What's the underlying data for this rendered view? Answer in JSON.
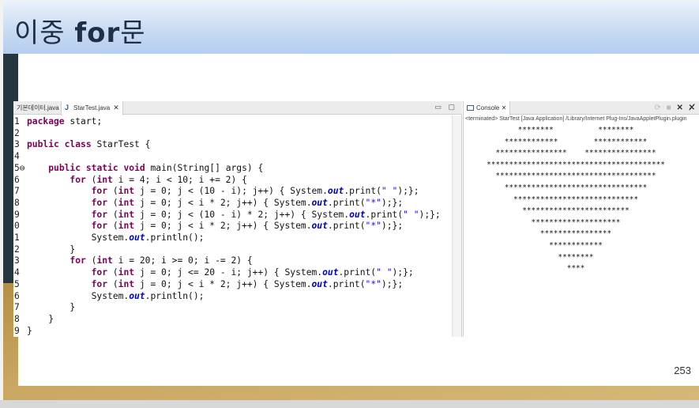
{
  "slide": {
    "title_korean_1": "이중 ",
    "title_bold": "for",
    "title_korean_2": "문",
    "page_number": "253"
  },
  "editor": {
    "tabs": [
      {
        "label": "기본데이터.java",
        "active": false
      },
      {
        "label": "StarTest.java",
        "active": true,
        "close": "✕",
        "icon": "J"
      }
    ],
    "controls": "▭ ▢",
    "lines": [
      {
        "num": "1",
        "segs": [
          [
            "kw",
            "package"
          ],
          [
            "plain",
            " start;"
          ]
        ]
      },
      {
        "num": "2",
        "segs": []
      },
      {
        "num": "3",
        "segs": [
          [
            "kw",
            "public"
          ],
          [
            "plain",
            " "
          ],
          [
            "kw",
            "class"
          ],
          [
            "plain",
            " StarTest {"
          ]
        ]
      },
      {
        "num": "4",
        "segs": []
      },
      {
        "num": "5⊖",
        "segs": [
          [
            "plain",
            "    "
          ],
          [
            "kw",
            "public"
          ],
          [
            "plain",
            " "
          ],
          [
            "kw",
            "static"
          ],
          [
            "plain",
            " "
          ],
          [
            "kw",
            "void"
          ],
          [
            "plain",
            " main(String[] args) {"
          ]
        ]
      },
      {
        "num": "6",
        "segs": [
          [
            "plain",
            "        "
          ],
          [
            "kw",
            "for"
          ],
          [
            "plain",
            " ("
          ],
          [
            "kw",
            "int"
          ],
          [
            "plain",
            " i = 4; i < 10; i += 2) {"
          ]
        ]
      },
      {
        "num": "7",
        "segs": [
          [
            "plain",
            "            "
          ],
          [
            "kw",
            "for"
          ],
          [
            "plain",
            " ("
          ],
          [
            "kw",
            "int"
          ],
          [
            "plain",
            " j = 0; j < (10 - i); j++) { System."
          ],
          [
            "fld",
            "out"
          ],
          [
            "plain",
            ".print("
          ],
          [
            "str",
            "\" \""
          ],
          [
            "plain",
            ");};"
          ]
        ]
      },
      {
        "num": "8",
        "segs": [
          [
            "plain",
            "            "
          ],
          [
            "kw",
            "for"
          ],
          [
            "plain",
            " ("
          ],
          [
            "kw",
            "int"
          ],
          [
            "plain",
            " j = 0; j < i * 2; j++) { System."
          ],
          [
            "fld",
            "out"
          ],
          [
            "plain",
            ".print("
          ],
          [
            "str",
            "\"*\""
          ],
          [
            "plain",
            ");};"
          ]
        ]
      },
      {
        "num": "9",
        "segs": [
          [
            "plain",
            "            "
          ],
          [
            "kw",
            "for"
          ],
          [
            "plain",
            " ("
          ],
          [
            "kw",
            "int"
          ],
          [
            "plain",
            " j = 0; j < (10 - i) * 2; j++) { System."
          ],
          [
            "fld",
            "out"
          ],
          [
            "plain",
            ".print("
          ],
          [
            "str",
            "\" \""
          ],
          [
            "plain",
            ");};"
          ]
        ]
      },
      {
        "num": "0",
        "segs": [
          [
            "plain",
            "            "
          ],
          [
            "kw",
            "for"
          ],
          [
            "plain",
            " ("
          ],
          [
            "kw",
            "int"
          ],
          [
            "plain",
            " j = 0; j < i * 2; j++) { System."
          ],
          [
            "fld",
            "out"
          ],
          [
            "plain",
            ".print("
          ],
          [
            "str",
            "\"*\""
          ],
          [
            "plain",
            ");};"
          ]
        ]
      },
      {
        "num": "1",
        "segs": [
          [
            "plain",
            "            System."
          ],
          [
            "fld",
            "out"
          ],
          [
            "plain",
            ".println();"
          ]
        ]
      },
      {
        "num": "2",
        "segs": [
          [
            "plain",
            "        }"
          ]
        ]
      },
      {
        "num": "3",
        "segs": [
          [
            "plain",
            "        "
          ],
          [
            "kw",
            "for"
          ],
          [
            "plain",
            " ("
          ],
          [
            "kw",
            "int"
          ],
          [
            "plain",
            " i = 20; i >= 0; i -= 2) {"
          ]
        ]
      },
      {
        "num": "4",
        "segs": [
          [
            "plain",
            "            "
          ],
          [
            "kw",
            "for"
          ],
          [
            "plain",
            " ("
          ],
          [
            "kw",
            "int"
          ],
          [
            "plain",
            " j = 0; j <= 20 - i; j++) { System."
          ],
          [
            "fld",
            "out"
          ],
          [
            "plain",
            ".print("
          ],
          [
            "str",
            "\" \""
          ],
          [
            "plain",
            ");};"
          ]
        ]
      },
      {
        "num": "5",
        "segs": [
          [
            "plain",
            "            "
          ],
          [
            "kw",
            "for"
          ],
          [
            "plain",
            " ("
          ],
          [
            "kw",
            "int"
          ],
          [
            "plain",
            " j = 0; j < i * 2; j++) { System."
          ],
          [
            "fld",
            "out"
          ],
          [
            "plain",
            ".print("
          ],
          [
            "str",
            "\"*\""
          ],
          [
            "plain",
            ");};"
          ]
        ]
      },
      {
        "num": "6",
        "segs": [
          [
            "plain",
            "            System."
          ],
          [
            "fld",
            "out"
          ],
          [
            "plain",
            ".println();"
          ]
        ]
      },
      {
        "num": "7",
        "segs": [
          [
            "plain",
            "        }"
          ]
        ]
      },
      {
        "num": "8",
        "segs": [
          [
            "plain",
            "    }"
          ]
        ]
      },
      {
        "num": "9",
        "segs": [
          [
            "plain",
            "}"
          ]
        ]
      }
    ]
  },
  "console": {
    "tab_label": "Console",
    "tab_close": "✕",
    "tools_faded": "⟳ ■",
    "tools_dark": "✕ ✕̸",
    "terminated": "<terminated> StarTest [Java Application] /Library/Internet Plug-Ins/JavaAppletPlugin.plugin",
    "output": [
      "********          ********",
      "************        ************",
      "****************    ****************",
      "****************************************",
      "************************************",
      "********************************",
      "****************************",
      "************************",
      "********************",
      "****************",
      "************",
      "********",
      "****"
    ]
  }
}
